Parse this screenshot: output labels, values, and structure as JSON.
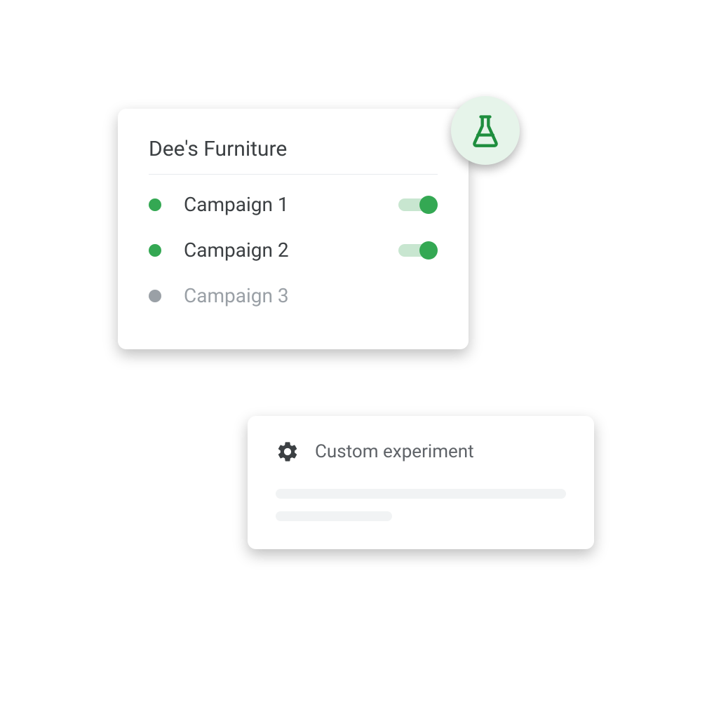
{
  "campaigns": {
    "title": "Dee's Furniture",
    "items": [
      {
        "label": "Campaign 1",
        "active": true
      },
      {
        "label": "Campaign 2",
        "active": true
      },
      {
        "label": "Campaign 3",
        "active": false
      }
    ]
  },
  "experiment": {
    "title": "Custom experiment"
  },
  "colors": {
    "green": "#34a853",
    "light_green": "#e6f4ea",
    "gray": "#9aa0a6",
    "text": "#3c4043"
  }
}
